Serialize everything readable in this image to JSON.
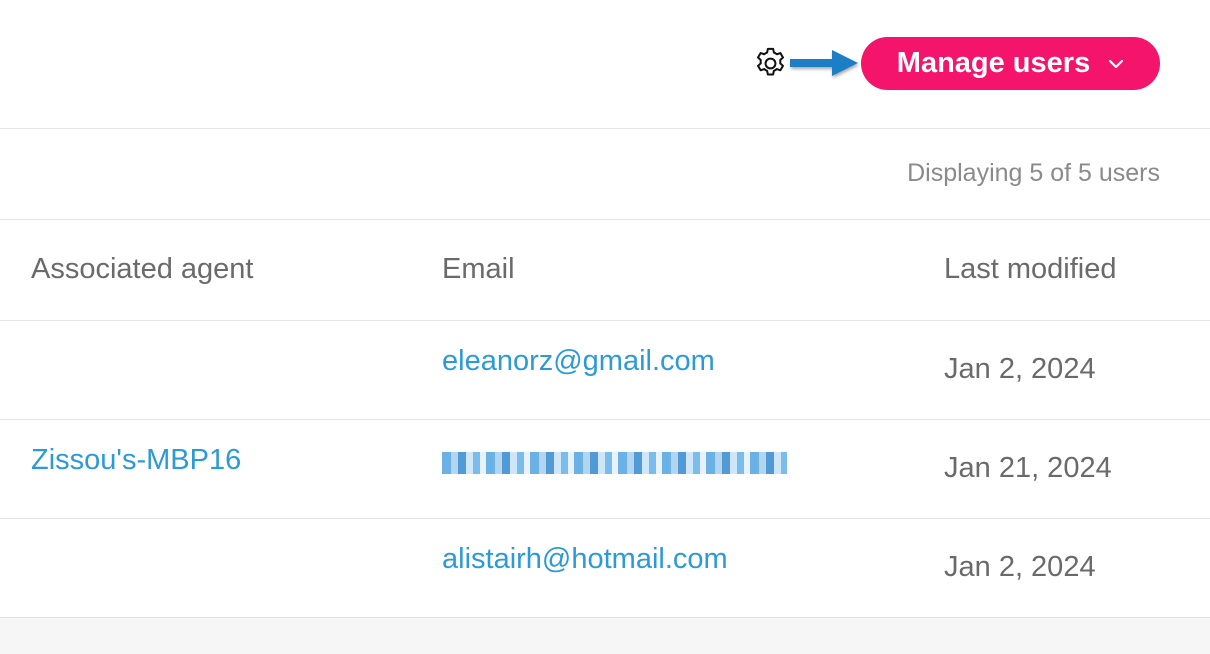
{
  "toolbar": {
    "manage_users_label": "Manage users",
    "accent_color": "#f4146b",
    "annotation_arrow_color": "#1d7ec4",
    "icons": [
      "gear-icon",
      "chevron-down-icon",
      "arrow-annotation"
    ]
  },
  "summary": {
    "count_text": "Displaying 5 of 5 users"
  },
  "table": {
    "columns": [
      "Associated agent",
      "Email",
      "Last modified"
    ],
    "rows": [
      {
        "agent": "",
        "email": "eleanorz@gmail.com",
        "last_modified": "Jan 2, 2024"
      },
      {
        "agent": "Zissou's-MBP16",
        "email": "",
        "email_redacted": true,
        "last_modified": "Jan 21, 2024"
      },
      {
        "agent": "",
        "email": "alistairh@hotmail.com",
        "last_modified": "Jan 2, 2024"
      }
    ]
  }
}
